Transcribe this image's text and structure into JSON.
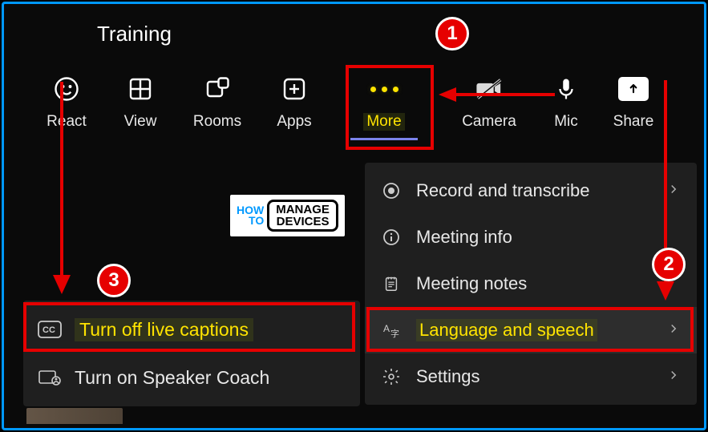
{
  "meeting": {
    "title": "Training"
  },
  "toolbar": {
    "react": "React",
    "view": "View",
    "rooms": "Rooms",
    "apps": "Apps",
    "more": "More",
    "camera": "Camera",
    "mic": "Mic",
    "share": "Share"
  },
  "dropdown": {
    "record": "Record and transcribe",
    "info": "Meeting info",
    "notes": "Meeting notes",
    "language": "Language and speech",
    "settings": "Settings"
  },
  "submenu": {
    "captions": "Turn off live captions",
    "speaker_coach": "Turn on Speaker Coach"
  },
  "annotations": {
    "step1": "1",
    "step2": "2",
    "step3": "3"
  },
  "watermark": {
    "line1": "HOW",
    "line2": "TO",
    "line3": "MANAGE",
    "line4": "DEVICES"
  },
  "colors": {
    "frame": "#0099ff",
    "highlight_box": "#e60000",
    "badge": "#e60000",
    "emphasis_text": "#ffe400",
    "active_underline": "#7b83eb"
  }
}
